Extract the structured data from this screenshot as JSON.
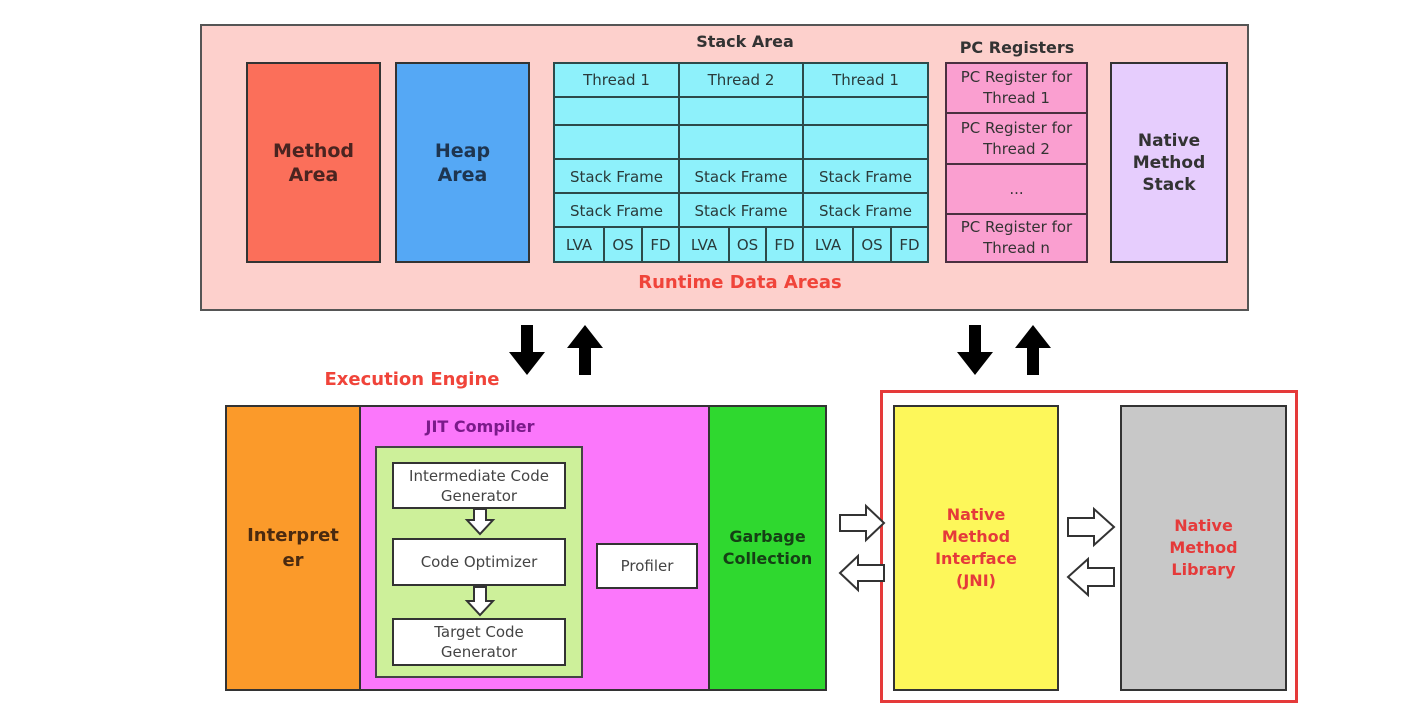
{
  "runtime": {
    "label": "Runtime Data Areas",
    "method_area": "Method\nArea",
    "heap_area": "Heap\nArea",
    "stack_area": {
      "title": "Stack Area",
      "threads": [
        "Thread 1",
        "Thread 2",
        "Thread 1"
      ],
      "stack_frame": "Stack Frame",
      "frame_parts": [
        "LVA",
        "OS",
        "FD"
      ]
    },
    "pc_registers": {
      "title": "PC Registers",
      "items": [
        "PC Register for\nThread 1",
        "PC Register for\nThread 2",
        "...",
        "PC Register for\nThread n"
      ]
    },
    "native_method_stack": "Native\nMethod\nStack"
  },
  "execution_engine": {
    "label": "Execution Engine",
    "interpreter": "Interpret\ner",
    "jit": {
      "title": "JIT Compiler",
      "steps": [
        "Intermediate Code\nGenerator",
        "Code Optimizer",
        "Target Code\nGenerator"
      ],
      "profiler": "Profiler"
    },
    "garbage_collection": "Garbage\nCollection"
  },
  "native": {
    "interface": "Native\nMethod\nInterface\n(JNI)",
    "library": "Native\nMethod\nLibrary"
  },
  "colors": {
    "runtime_bg": "#fdd0cc",
    "method_area": "#fb6f5a",
    "heap_area": "#55a8f5",
    "stack_cell": "#8ef1fb",
    "pc_register": "#fa9fd0",
    "native_stack": "#e6cdfd",
    "interpreter": "#fb9a2a",
    "jit": "#fb77fb",
    "jit_inner": "#cdf09a",
    "gc": "#2fd82f",
    "jni": "#fdf75a",
    "library": "#c8c8c8",
    "highlight": "#e53a3a"
  }
}
